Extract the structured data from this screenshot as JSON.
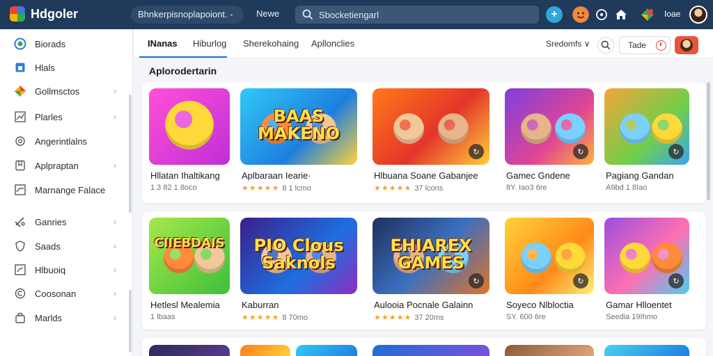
{
  "app": {
    "brand": "Hdgoler"
  },
  "header": {
    "url": "Bhnkerpisnoplapoiont. -",
    "new_label": "Newe",
    "search_placeholder": "Sbocketiengarl",
    "user_name": "Ioae"
  },
  "sidebar": {
    "items": [
      {
        "label": "Biorads",
        "icon": "circle-app-icon",
        "chevron": false
      },
      {
        "label": "Hlals",
        "icon": "home-icon",
        "chevron": false
      },
      {
        "label": "Gollmsctos",
        "icon": "gift-icon",
        "chevron": true
      },
      {
        "label": "Plarles",
        "icon": "chart-icon",
        "chevron": true
      },
      {
        "label": "Angerintlalns",
        "icon": "settings-icon",
        "chevron": false
      },
      {
        "label": "Aplpraptan",
        "icon": "bookmark-icon",
        "chevron": true
      },
      {
        "label": "Marnange Falace",
        "icon": "trend-icon",
        "chevron": false
      },
      {
        "label": "Ganries",
        "icon": "controller-icon",
        "chevron": true
      },
      {
        "label": "Saads",
        "icon": "shield-icon",
        "chevron": true
      },
      {
        "label": "Hlbuoiq",
        "icon": "library-icon",
        "chevron": true
      },
      {
        "label": "Coosonan",
        "icon": "copyright-icon",
        "chevron": true
      },
      {
        "label": "Marlds",
        "icon": "bag-icon",
        "chevron": true
      }
    ]
  },
  "tabs": [
    {
      "label": "INanas",
      "active": true
    },
    {
      "label": "Hiburlog",
      "active": false
    },
    {
      "label": "Sherekohaing",
      "active": false
    },
    {
      "label": "Apllonclies",
      "active": false
    }
  ],
  "toolbar": {
    "sort_label": "Sredomfs ∨",
    "trade_label": "Tade"
  },
  "section": {
    "title": "Aplorodertarin"
  },
  "rows": [
    {
      "cards": [
        {
          "title": "Hllatan Ihaltikang",
          "meta": "1 3 82 1 8oco",
          "stars": "",
          "thumb_text": ""
        },
        {
          "title": "Aplbaraan Iearie·",
          "meta": "8 1 lcmo",
          "stars": "★★★★★",
          "thumb_text": "BAAS MAKENO"
        },
        {
          "title": "Hlbuana Soane Gabanjee",
          "meta": "37 lcons",
          "stars": "★★★★★",
          "thumb_text": ""
        },
        {
          "title": "Gamec Gndene",
          "meta": "8Y. Iao3 6re",
          "stars": "",
          "thumb_text": ""
        },
        {
          "title": "Pagiang Gandan",
          "meta": "A9bd 1 8Iao",
          "stars": "",
          "thumb_text": ""
        }
      ]
    },
    {
      "cards": [
        {
          "title": "Hetlesl Mealemia",
          "meta": "1 lbaas",
          "stars": "",
          "thumb_text": "CIIEBDAIS"
        },
        {
          "title": "Kaburran",
          "meta": "8 70mo",
          "stars": "★★★★★",
          "thumb_text": "PIO Clous Saknols"
        },
        {
          "title": "Aulooia Pocnale Galainn",
          "meta": "37 20ms",
          "stars": "★★★★★",
          "thumb_text": "EHIAREX GAMES"
        },
        {
          "title": "Soyeco Nlbloctia",
          "meta": "SY. 600 6re",
          "stars": "",
          "thumb_text": ""
        },
        {
          "title": "Gamar Hlloentet",
          "meta": "Seedia 19Ihmo",
          "stars": "",
          "thumb_text": ""
        }
      ]
    }
  ],
  "colors": {
    "topbar": "#1f3a5a",
    "accent": "#1f6bd6",
    "star": "#f5a623"
  }
}
